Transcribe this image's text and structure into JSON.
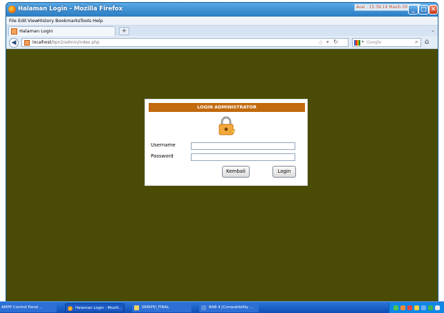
{
  "window": {
    "title": "Halaman Login - Mozilla Firefox",
    "clock_text": "Aval : 15:39:19  Masih 00:21"
  },
  "menu": {
    "items": [
      "File",
      "Edit",
      "View",
      "History",
      "Bookmarks",
      "Tools",
      "Help"
    ]
  },
  "tabs": {
    "active_label": "Halaman Login",
    "new_tab": "+"
  },
  "nav": {
    "url_host": "localhost",
    "url_path": "/bpn2/admin/index.php",
    "search_placeholder": "Google"
  },
  "login": {
    "header": "LOGIN ADMINISTRATOR",
    "username_label": "Username",
    "password_label": "Password",
    "username_value": "",
    "password_value": "",
    "back_button": "Kembali",
    "login_button": "Login"
  },
  "taskbar": {
    "items": [
      "AMPP Control Panel ...",
      "Halaman Login - Mozill...",
      "SKRIPSI_FINAL",
      "BAB 4 [Compatibility ..."
    ]
  },
  "colors": {
    "page_background": "#4a4c05",
    "login_header": "#c26a0e",
    "titlebar": "#2a7cc2",
    "taskbar": "#1a5fc8"
  }
}
